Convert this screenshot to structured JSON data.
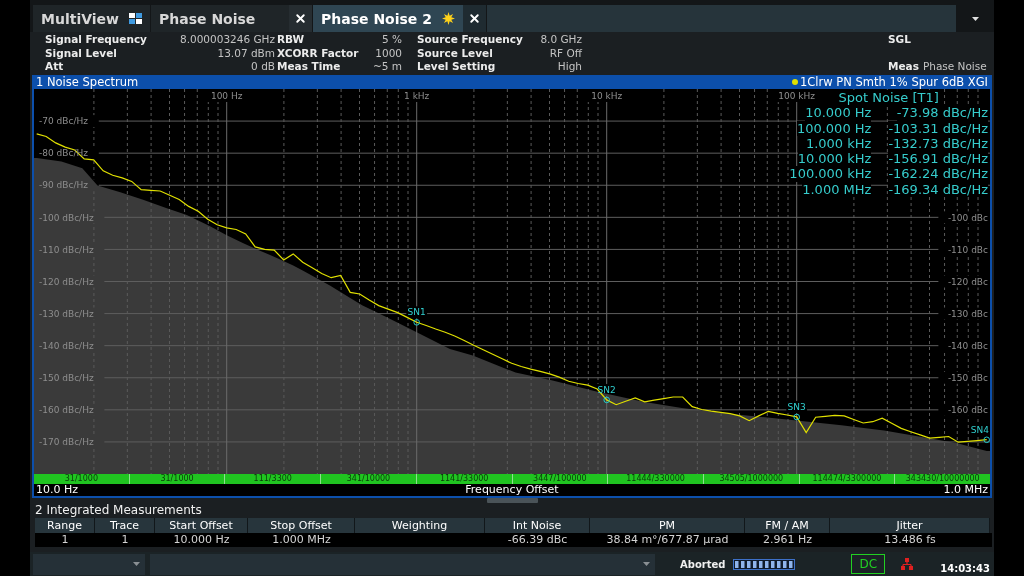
{
  "tabs": [
    {
      "label": "MultiView",
      "kind": "multiview",
      "selected": false
    },
    {
      "label": "Phase Noise",
      "kind": "measurement",
      "selected": false,
      "starred": false
    },
    {
      "label": "Phase Noise 2",
      "kind": "measurement",
      "selected": true,
      "starred": true
    }
  ],
  "info": {
    "groups": [
      [
        {
          "label": "Signal Frequency",
          "value": "8.000003246 GHz"
        },
        {
          "label": "Signal Level",
          "value": "13.07 dBm"
        },
        {
          "label": "Att",
          "value": "0 dB"
        }
      ],
      [
        {
          "label": "RBW",
          "value": "5 %"
        },
        {
          "label": "XCORR Factor",
          "value": "1000"
        },
        {
          "label": "Meas Time",
          "value": "~5 m"
        }
      ],
      [
        {
          "label": "Source Frequency",
          "value": "8.0 GHz"
        },
        {
          "label": "Source Level",
          "value": "RF Off"
        },
        {
          "label": "Level Setting",
          "value": "High"
        }
      ]
    ],
    "sweep_mode": "SGL",
    "measurement": {
      "label": "Meas",
      "value": "Phase Noise"
    }
  },
  "noise_spectrum": {
    "title": "1 Noise Spectrum",
    "trace_legend": "1Clrw PN Smth 1% Spur 6dB XGI",
    "chart_data": {
      "type": "line",
      "grid": true,
      "xlabel": "Frequency Offset",
      "ylim": [
        -180,
        -60
      ],
      "y2lim": [
        -180,
        -60
      ],
      "categories": [
        null,
        null,
        null,
        null,
        null,
        null,
        null,
        null,
        null,
        null,
        null,
        null,
        null,
        null,
        null,
        null,
        null,
        null,
        null,
        null,
        "100 Hz",
        null,
        null,
        null,
        null,
        null,
        null,
        null,
        null,
        null,
        null,
        null,
        null,
        null,
        null,
        null,
        null,
        null,
        null,
        null,
        "1 kHz",
        null,
        null,
        null,
        null,
        null,
        null,
        null,
        null,
        null,
        null,
        null,
        null,
        null,
        null,
        null,
        null,
        null,
        null,
        null,
        "10 kHz",
        null,
        null,
        null,
        null,
        null,
        null,
        null,
        null,
        null,
        null,
        null,
        null,
        null,
        null,
        null,
        null,
        null,
        null,
        null,
        "100 kHz",
        null,
        null,
        null,
        null,
        null,
        null,
        null,
        null,
        null,
        null,
        null,
        null,
        null,
        null,
        null,
        null,
        null,
        null,
        null,
        null
      ],
      "yticks": [
        {
          "value": -70,
          "label": "-70 dBc/Hz"
        },
        {
          "value": -80,
          "label": "-80 dBc/Hz"
        },
        {
          "value": -90,
          "label": "-90 dBc/Hz"
        },
        {
          "value": -100,
          "label": "-100 dBc/Hz"
        },
        {
          "value": -110,
          "label": "-110 dBc/Hz"
        },
        {
          "value": -120,
          "label": "-120 dBc/Hz"
        },
        {
          "value": -130,
          "label": "-130 dBc/Hz"
        },
        {
          "value": -140,
          "label": "-140 dBc/Hz"
        },
        {
          "value": -150,
          "label": "-150 dBc/Hz"
        },
        {
          "value": -160,
          "label": "-160 dBc/Hz"
        },
        {
          "value": -170,
          "label": "-170 dBc/Hz"
        }
      ],
      "y2ticks": [
        {
          "value": -100,
          "label": "-100 dBc"
        },
        {
          "value": -110,
          "label": "-110 dBc"
        },
        {
          "value": -120,
          "label": "-120 dBc"
        },
        {
          "value": -130,
          "label": "-130 dBc"
        },
        {
          "value": -140,
          "label": "-140 dBc"
        },
        {
          "value": -150,
          "label": "-150 dBc"
        },
        {
          "value": -160,
          "label": "-160 dBc"
        }
      ],
      "series": [
        {
          "color": "#e0e000",
          "values": [
            -74.0,
            -74.8,
            -76.8,
            -78.1,
            -79.0,
            -81.8,
            -82.1,
            -85.5,
            -86.9,
            -87.7,
            -88.8,
            -91.4,
            -91.6,
            -91.8,
            -93.1,
            -94.4,
            -96.6,
            -98.1,
            -100.6,
            -102.3,
            -103.3,
            -103.8,
            -105.2,
            -109.2,
            -110.0,
            -110.2,
            -113.3,
            -111.4,
            -114.0,
            -115.7,
            -117.5,
            -118.8,
            -118.1,
            -123.4,
            -123.9,
            -125.8,
            -127.5,
            -128.6,
            -129.7,
            -131.2,
            -132.7,
            -133.7,
            -134.8,
            -135.8,
            -137.0,
            -138.4,
            -139.9,
            -141.3,
            -142.7,
            -144.1,
            -145.5,
            -146.5,
            -147.3,
            -148.0,
            -148.8,
            -149.8,
            -151.1,
            -151.8,
            -152.3,
            -153.5,
            -156.9,
            -158.4,
            -157.3,
            -156.3,
            -157.5,
            -157.0,
            -156.5,
            -156.0,
            -156.0,
            -159.0,
            -159.9,
            -160.4,
            -160.8,
            -161.2,
            -161.9,
            -163.4,
            -161.9,
            -160.5,
            -161.1,
            -161.6,
            -162.2,
            -167.1,
            -162.3,
            -162.0,
            -161.7,
            -161.9,
            -163.0,
            -164.1,
            -163.7,
            -162.6,
            -164.2,
            -165.8,
            -166.8,
            -167.8,
            -168.8,
            -168.6,
            -168.3,
            -170.1,
            -169.8,
            -169.6,
            -169.3
          ]
        }
      ],
      "annotations": [
        {
          "text": "SN1",
          "y": -132.73
        },
        {
          "text": "SN2",
          "y": -156.91
        },
        {
          "text": "SN3",
          "y": -162.24
        },
        {
          "text": "SN4",
          "y": -169.34
        }
      ]
    },
    "spot_noise": {
      "title": "Spot Noise [T1]",
      "rows": [
        {
          "offset": "10.000 Hz",
          "value": "-73.98 dBc/Hz"
        },
        {
          "offset": "100.000 Hz",
          "value": "-103.31 dBc/Hz"
        },
        {
          "offset": "1.000 kHz",
          "value": "-132.73 dBc/Hz"
        },
        {
          "offset": "10.000 kHz",
          "value": "-156.91 dBc/Hz"
        },
        {
          "offset": "100.000 kHz",
          "value": "-162.24 dBc/Hz"
        },
        {
          "offset": "1.000 MHz",
          "value": "-169.34 dBc/Hz"
        }
      ]
    },
    "xcorr_segments": [
      "31/1000",
      "31/1000",
      "111/3300",
      "341/10000",
      "1141/33000",
      "3447/100000",
      "11444/330000",
      "34505/1000000",
      "114474/3300000",
      "343430/10000000"
    ],
    "x_start": "10.0 Hz",
    "x_stop": "1.0 MHz"
  },
  "integrated_measurements": {
    "title": "2 Integrated Measurements",
    "columns": [
      "Range",
      "Trace",
      "Start Offset",
      "Stop Offset",
      "Weighting",
      "Int Noise",
      "PM",
      "FM / AM",
      "Jitter"
    ],
    "rows": [
      [
        "1",
        "1",
        "10.000 Hz",
        "1.000 MHz",
        null,
        "-66.39 dBc",
        "38.84 m°/677.87 µrad",
        "2.961 Hz",
        "13.486 fs"
      ]
    ]
  },
  "status_bar": {
    "status": "Aborted",
    "coupling": "DC",
    "time": "14:03:43"
  }
}
